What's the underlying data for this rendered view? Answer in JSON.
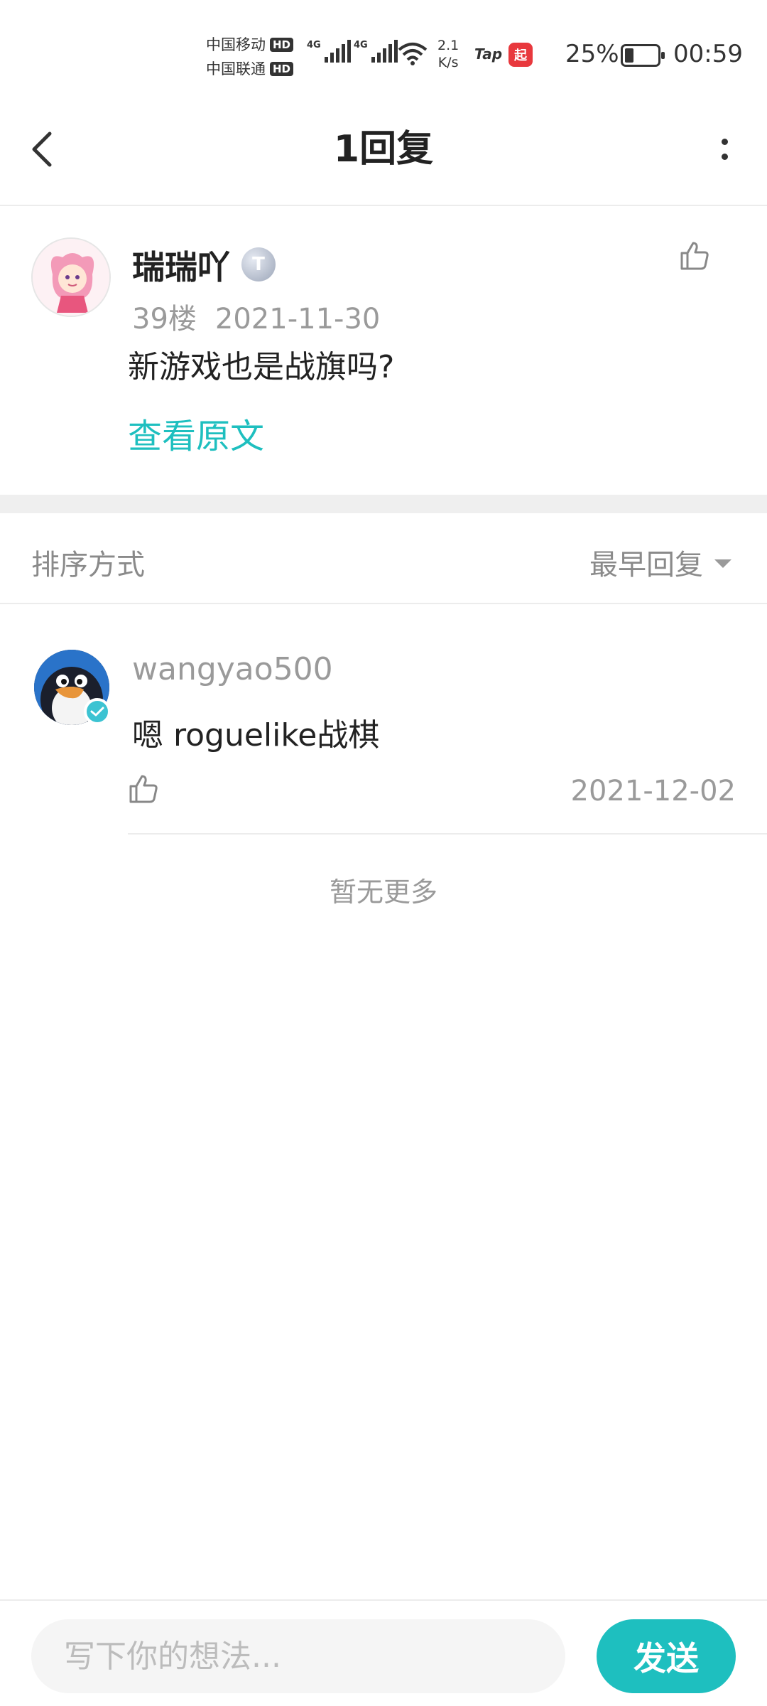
{
  "status_bar": {
    "carrier_1": "中国移动",
    "carrier_2": "中国联通",
    "hd_badge": "HD",
    "network_tag": "4G",
    "net_speed_value": "2.1",
    "net_speed_unit": "K/s",
    "tap_app_label": "Tap",
    "qidian_app_label": "起",
    "battery_percent": "25%",
    "time": "00:59"
  },
  "header": {
    "title": "1回复",
    "back_icon": "chevron-left-icon",
    "more_icon": "more-vertical-icon"
  },
  "post": {
    "author": "瑞瑞吖",
    "level_badge": "T",
    "floor": "39楼",
    "date": "2021-11-30",
    "content": "新游戏也是战旗吗?",
    "view_original_label": "查看原文",
    "like_icon": "thumbs-up-icon"
  },
  "sort": {
    "label": "排序方式",
    "selected": "最早回复"
  },
  "replies": [
    {
      "author": "wangyao500",
      "content": "嗯 roguelike战棋",
      "date": "2021-12-02",
      "verified_icon": "verified-check-icon",
      "like_icon": "thumbs-up-icon"
    }
  ],
  "footer_note": "暂无更多",
  "composer": {
    "placeholder": "写下你的想法...",
    "send_label": "发送"
  },
  "colors": {
    "accent": "#1ebfbf",
    "muted_text": "#9a9a9a",
    "divider": "#efefef"
  }
}
